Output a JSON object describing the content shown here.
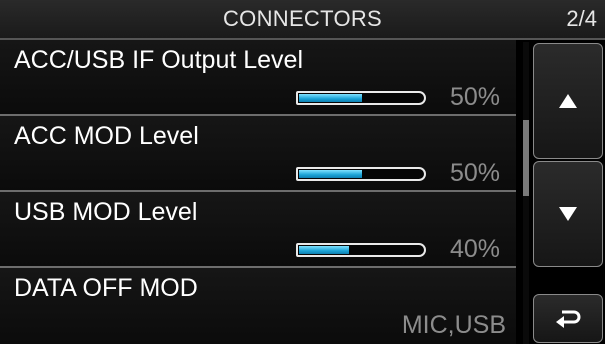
{
  "header": {
    "title": "CONNECTORS",
    "page_indicator": "2/4"
  },
  "items": [
    {
      "label": "ACC/USB IF Output Level",
      "level": 0.5,
      "value": "50%"
    },
    {
      "label": "ACC MOD Level",
      "level": 0.5,
      "value": "50%"
    },
    {
      "label": "USB MOD Level",
      "level": 0.4,
      "value": "40%"
    },
    {
      "label": "DATA OFF MOD",
      "value": "MIC,USB"
    }
  ],
  "buttons": {
    "up_icon": "triangle-up-icon",
    "down_icon": "triangle-down-icon",
    "back_icon": "return-arrow-icon"
  },
  "colors": {
    "meter_fill": "#1ba3d6",
    "value_text": "#8c8c8c"
  }
}
